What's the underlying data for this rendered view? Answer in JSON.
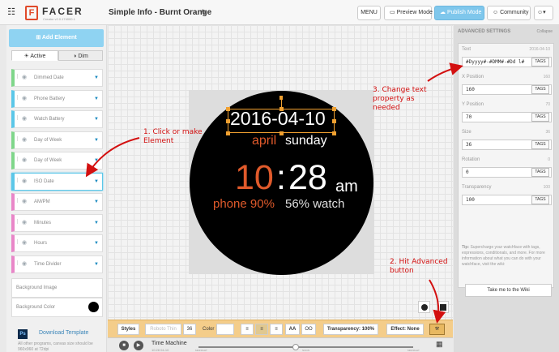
{
  "topbar": {
    "logo_text": "FACER",
    "logo_subtext": "Creator v2.0.174000.1",
    "document_title": "Simple Info - Burnt Orange",
    "menu_label": "MENU",
    "preview_label": "Preview Mode",
    "publish_label": "Publish Mode",
    "community_label": "Community"
  },
  "left_panel": {
    "add_element_label": "Add Element",
    "tabs": [
      {
        "label": "Active"
      },
      {
        "label": "Dim"
      }
    ],
    "layers": [
      {
        "label": "Dimmed Date",
        "color": "#7fd68a"
      },
      {
        "label": "Phone Battery",
        "color": "#5bc7e8"
      },
      {
        "label": "Watch Battery",
        "color": "#5bc7e8"
      },
      {
        "label": "Day of Week",
        "color": "#7fd68a"
      },
      {
        "label": "Day of Week",
        "color": "#7fd68a"
      },
      {
        "label": "ISO Date",
        "color": "#5bc7e8"
      },
      {
        "label": "AM/PM",
        "color": "#e986c8"
      },
      {
        "label": "Minutes",
        "color": "#e986c8"
      },
      {
        "label": "Hours",
        "color": "#e986c8"
      },
      {
        "label": "Time Divider",
        "color": "#e986c8"
      }
    ],
    "background_image_label": "Background Image",
    "background_color_label": "Background Color",
    "background_color": "#000000",
    "download_template_label": "Download Template",
    "download_note": "All other programs, canvas size should be 960x960 at 72dpi"
  },
  "watch": {
    "date": "2016-04-10",
    "month": "april",
    "day": "sunday",
    "hour": "10",
    "colon": ":",
    "minute": "28",
    "ampm": "am",
    "phone_battery": "phone 90%",
    "watch_battery": "56% watch",
    "accent_color": "#e05a2b"
  },
  "style_bar": {
    "styles_label": "Styles",
    "font_name": "Roboto Thin",
    "font_size": "36",
    "color_label": "Color",
    "caps_label": "AA",
    "opacity_label": "OO",
    "transparency_label": "Transparency: 100%",
    "effect_label": "Effect: None"
  },
  "time_machine": {
    "label": "Time Machine",
    "value": "10:28 04-10",
    "left_tick": "MIDNIGHT",
    "mid_tick": "NOON",
    "right_tick": "MIDNIGHT"
  },
  "advanced": {
    "title": "ADVANCED SETTINGS",
    "collapse_label": "Collapse",
    "tags_label": "TAGS",
    "properties": [
      {
        "label": "Text",
        "value": "2016-04-10",
        "input": "#Dyyyy#-#DMM#-#Dd l#"
      },
      {
        "label": "X Position",
        "value": "160",
        "input": "160"
      },
      {
        "label": "Y Position",
        "value": "70",
        "input": "70"
      },
      {
        "label": "Size",
        "value": "36",
        "input": "36"
      },
      {
        "label": "Rotation",
        "value": "0",
        "input": "0"
      },
      {
        "label": "Transparency",
        "value": "100",
        "input": "100"
      }
    ],
    "tip_label": "Tip:",
    "tip_text": "Supercharge your watchface with tags, expressions, conditionals, and more. For more information about what you can do with your watchface, visit the wiki:",
    "wiki_button": "Take me to the Wiki"
  },
  "annotations": {
    "step1": [
      "1. Click or make",
      "Element"
    ],
    "step2": [
      "2. Hit Advanced",
      "button"
    ],
    "step3": [
      "3. Change text",
      "property as",
      "needed"
    ]
  }
}
